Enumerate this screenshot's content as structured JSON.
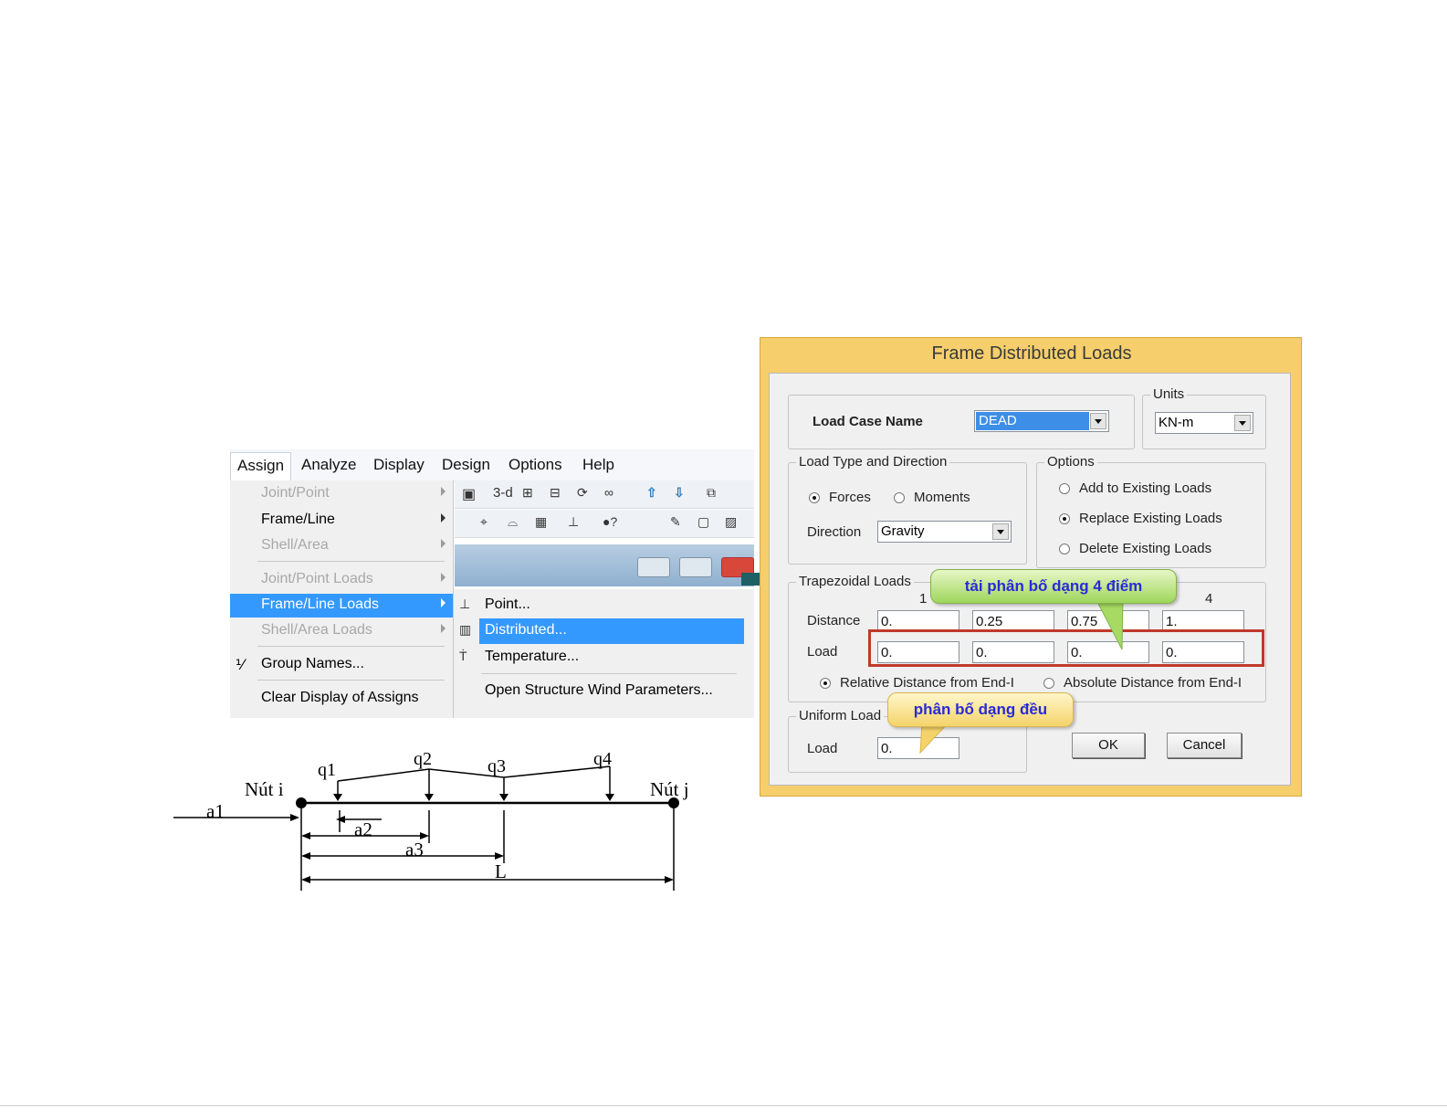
{
  "menu": {
    "bar": [
      "Assign",
      "Analyze",
      "Display",
      "Design",
      "Options",
      "Help"
    ],
    "assign_items": [
      {
        "label": "Joint/Point",
        "enabled": false,
        "submenu": true
      },
      {
        "label": "Frame/Line",
        "enabled": true,
        "submenu": true
      },
      {
        "label": "Shell/Area",
        "enabled": false,
        "submenu": true
      },
      {
        "label": "Joint/Point Loads",
        "enabled": false,
        "submenu": true
      },
      {
        "label": "Frame/Line Loads",
        "enabled": true,
        "submenu": true,
        "highlighted": true
      },
      {
        "label": "Shell/Area Loads",
        "enabled": false,
        "submenu": true
      },
      {
        "label": "Group Names...",
        "enabled": true,
        "submenu": false
      },
      {
        "label": "Clear Display of Assigns",
        "enabled": true,
        "submenu": false
      }
    ],
    "sub_items": [
      {
        "label": "Point..."
      },
      {
        "label": "Distributed...",
        "highlighted": true
      },
      {
        "label": "Temperature..."
      },
      {
        "label": "Open Structure Wind Parameters..."
      }
    ],
    "toolbar_label": "3-d",
    "highlight_color": "#3399ff"
  },
  "dialog": {
    "title": "Frame Distributed Loads",
    "load_case_label": "Load Case Name",
    "load_case_value": "DEAD",
    "units_label": "Units",
    "units_value": "KN-m",
    "load_type_label": "Load Type and Direction",
    "forces_label": "Forces",
    "moments_label": "Moments",
    "load_type_selected": "Forces",
    "direction_label": "Direction",
    "direction_value": "Gravity",
    "options_label": "Options",
    "options": [
      "Add to Existing Loads",
      "Replace Existing Loads",
      "Delete Existing Loads"
    ],
    "option_selected": "Replace Existing Loads",
    "trap_label": "Trapezoidal Loads",
    "col1": "1",
    "col4": "4",
    "distance_label": "Distance",
    "distances": [
      "0.",
      "0.25",
      "0.75",
      "1."
    ],
    "load_label": "Load",
    "loads": [
      "0.",
      "0.",
      "0.",
      "0."
    ],
    "relative_label": "Relative Distance from End-I",
    "absolute_label": "Absolute Distance from End-I",
    "distance_mode_selected": "Relative Distance from End-I",
    "uniform_label": "Uniform Load",
    "uniform_load_label": "Load",
    "uniform_value": "0.",
    "ok_label": "OK",
    "cancel_label": "Cancel",
    "frame_color": "#f6cf6c"
  },
  "callouts": {
    "trapezoid": "tải phân bố dạng 4 điểm",
    "uniform": "phân bố dạng đều"
  },
  "diagram": {
    "node_i": "Nút i",
    "node_j": "Nút j",
    "q_labels": [
      "q1",
      "q2",
      "q3",
      "q4"
    ],
    "dims": [
      "a1",
      "a2",
      "a3",
      "L"
    ]
  }
}
